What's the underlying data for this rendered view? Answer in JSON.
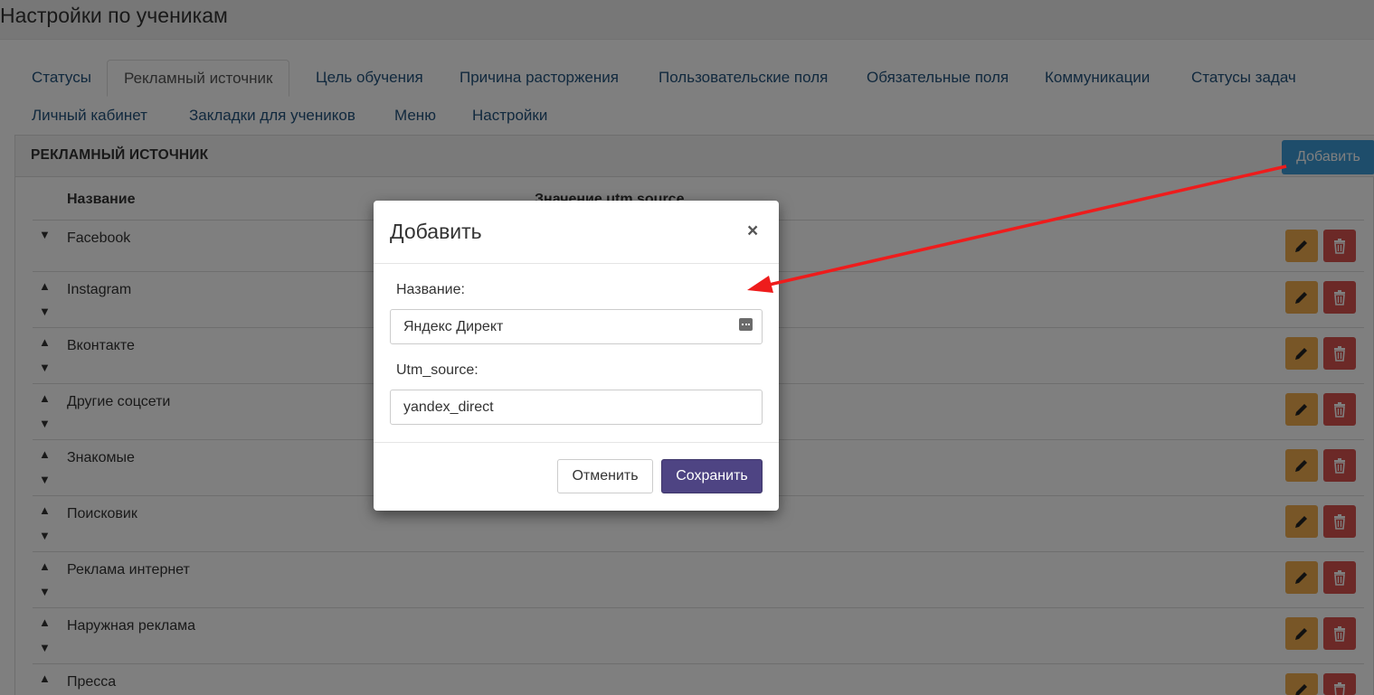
{
  "page": {
    "title": "Настройки по ученикам"
  },
  "tabs": [
    {
      "label": "Статусы"
    },
    {
      "label": "Рекламный источник"
    },
    {
      "label": "Цель обучения"
    },
    {
      "label": "Причина расторжения"
    },
    {
      "label": "Пользовательские поля"
    },
    {
      "label": "Обязательные поля"
    },
    {
      "label": "Коммуникации"
    },
    {
      "label": "Статусы задач"
    },
    {
      "label": "Личный кабинет"
    },
    {
      "label": "Закладки для учеников"
    },
    {
      "label": "Меню"
    },
    {
      "label": "Настройки"
    }
  ],
  "panel": {
    "title": "РЕКЛАМНЫЙ ИСТОЧНИК",
    "add_label": "Добавить",
    "columns": [
      "Название",
      "Значение utm source"
    ],
    "rows": [
      {
        "name": "Facebook"
      },
      {
        "name": "Instagram"
      },
      {
        "name": "Вконтакте"
      },
      {
        "name": "Другие соцсети"
      },
      {
        "name": "Знакомые"
      },
      {
        "name": "Поисковик"
      },
      {
        "name": "Реклама интернет"
      },
      {
        "name": "Наружная реклама"
      },
      {
        "name": "Пресса"
      }
    ],
    "arrow_up": "▲",
    "arrow_down": "▼"
  },
  "modal": {
    "title": "Добавить",
    "close": "×",
    "name_label": "Название:",
    "name_value": "Яндекс Директ",
    "utm_label": "Utm_source:",
    "utm_value": "yandex_direct",
    "cancel_label": "Отменить",
    "save_label": "Сохранить"
  },
  "colors": {
    "add_button": "#3c9ad6",
    "edit_button": "#f0ad4e",
    "delete_button": "#d9534f",
    "save_button": "#4e4483",
    "annotation_arrow": "#ee1c1c"
  }
}
